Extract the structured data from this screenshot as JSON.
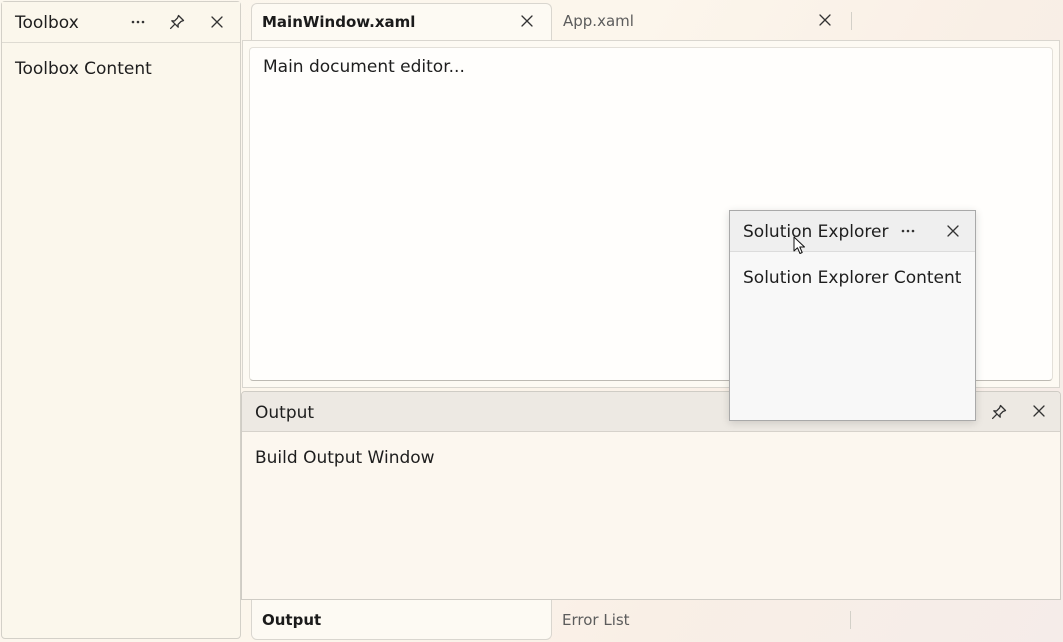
{
  "toolbox": {
    "title": "Toolbox",
    "content": "Toolbox Content",
    "icons": [
      "more-options-icon",
      "pin-icon",
      "close-icon"
    ]
  },
  "documents": {
    "tabs": [
      {
        "label": "MainWindow.xaml",
        "active": true
      },
      {
        "label": "App.xaml",
        "active": false
      }
    ],
    "editor_text": "Main document editor..."
  },
  "solution_explorer": {
    "title": "Solution Explorer",
    "content": "Solution Explorer Content",
    "icons": [
      "more-options-icon",
      "close-icon"
    ]
  },
  "output": {
    "title": "Output",
    "content": "Build Output Window",
    "icons": [
      "pin-icon",
      "close-icon"
    ],
    "tabs": [
      {
        "label": "Output",
        "active": true
      },
      {
        "label": "Error List",
        "active": false
      }
    ]
  },
  "colors": {
    "background": "#fbf7ee",
    "pane_header": "#ede9e3",
    "border": "#d3d0c8",
    "text": "#1e1e1e",
    "muted_text": "#5c5c5c"
  }
}
